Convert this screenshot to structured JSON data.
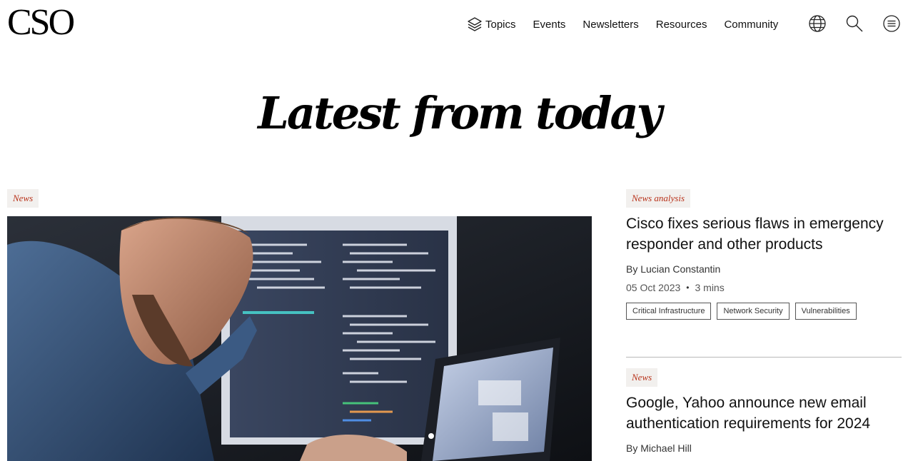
{
  "header": {
    "logo": "CSO",
    "nav": [
      {
        "label": "Topics",
        "icon": "layers-icon"
      },
      {
        "label": "Events"
      },
      {
        "label": "Newsletters"
      },
      {
        "label": "Resources"
      },
      {
        "label": "Community"
      }
    ],
    "icons": [
      "globe-icon",
      "search-icon",
      "menu-icon"
    ]
  },
  "main": {
    "title": "Latest from today",
    "hero": {
      "kicker": "News",
      "image_alt": "man-looking-at-laptop-with-code-monitors"
    },
    "articles": [
      {
        "kicker": "News analysis",
        "headline": "Cisco fixes serious flaws in emergency responder and other products",
        "byline": "By Lucian Constantin",
        "date": "05 Oct 2023",
        "read_time": "3 mins",
        "tags": [
          "Critical Infrastructure",
          "Network Security",
          "Vulnerabilities"
        ]
      },
      {
        "kicker": "News",
        "headline": "Google, Yahoo announce new email authentication requirements for 2024",
        "byline": "By Michael Hill"
      }
    ]
  },
  "colors": {
    "accent": "#b8321a",
    "kicker_bg": "#f2f0ee",
    "divider": "#b9b9b9"
  }
}
